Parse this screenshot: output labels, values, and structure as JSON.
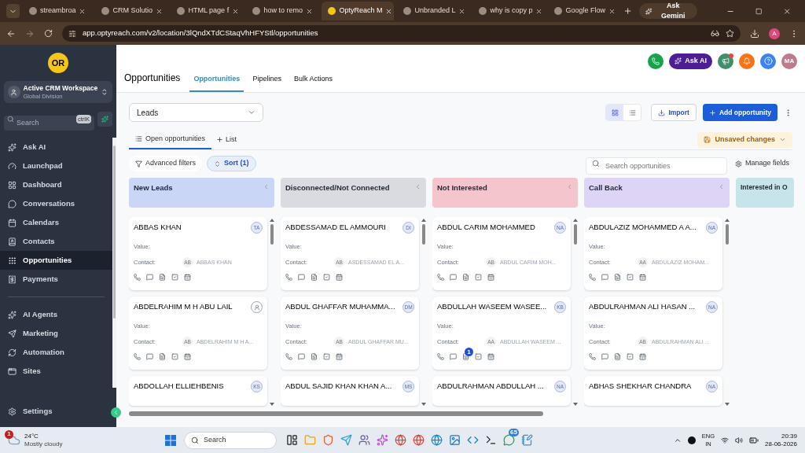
{
  "browser": {
    "tabs": [
      {
        "title": "streambroa",
        "selected": false
      },
      {
        "title": "CRM Solutio",
        "selected": false
      },
      {
        "title": "HTML page f",
        "selected": false
      },
      {
        "title": "how to remo",
        "selected": false
      },
      {
        "title": "OptyReach M",
        "selected": true
      },
      {
        "title": "Unbranded L",
        "selected": false
      },
      {
        "title": "why is copy p",
        "selected": false
      },
      {
        "title": "Google Flow",
        "selected": false
      }
    ],
    "gemini": "Ask Gemini",
    "url": "app.optyreach.com/v2/location/3lQndXTdCStaqVhHFYStl/opportunities",
    "profile": "A"
  },
  "sidebar": {
    "logo": "OR",
    "workspace": {
      "name": "Active CRM Workspace",
      "sub": "Global Division"
    },
    "search": {
      "placeholder": "Search",
      "shortcut": "ctrlK"
    },
    "groups": [
      [
        {
          "label": "Ask AI",
          "selected": false
        },
        {
          "label": "Launchpad",
          "selected": false
        },
        {
          "label": "Dashboard",
          "selected": false
        },
        {
          "label": "Conversations",
          "selected": false
        },
        {
          "label": "Calendars",
          "selected": false
        },
        {
          "label": "Contacts",
          "selected": false
        },
        {
          "label": "Opportunities",
          "selected": true
        },
        {
          "label": "Payments",
          "selected": false
        }
      ],
      [
        {
          "label": "AI Agents",
          "selected": false
        },
        {
          "label": "Marketing",
          "selected": false
        },
        {
          "label": "Automation",
          "selected": false
        },
        {
          "label": "Sites",
          "selected": false
        }
      ]
    ],
    "settings": "Settings"
  },
  "header": {
    "title": "Opportunities",
    "tabs": [
      {
        "label": "Opportunities",
        "selected": true
      },
      {
        "label": "Pipelines",
        "selected": false
      },
      {
        "label": "Bulk Actions",
        "selected": false
      }
    ],
    "ask_ai": "Ask AI",
    "announcements_unread": true,
    "avatar": "MA"
  },
  "toolbar": {
    "pipeline": "Leads",
    "view_modes": [
      {
        "kind": "board",
        "selected": true
      },
      {
        "kind": "list",
        "selected": false
      }
    ],
    "import": "Import",
    "add": "Add opportunity",
    "view_tabs": [
      {
        "label": "Open opportunities",
        "selected": true
      }
    ],
    "add_list": "List",
    "unsaved": "Unsaved changes",
    "filters": "Advanced filters",
    "sort": "Sort (1)",
    "search_placeholder": "Search opportunities",
    "manage": "Manage fields"
  },
  "columns": [
    {
      "title": "New Leads",
      "color": "#c9d6f6",
      "cards": [
        {
          "kind": "full",
          "name": "ABBAS KHAN",
          "owner": {
            "kind": "initials",
            "text": "TA"
          },
          "value_label": "Value:",
          "contact_label": "Contact:",
          "contact_initials": "AB",
          "contact_name": "ABBAS KHAN"
        },
        {
          "kind": "full",
          "name": "ABDELRAHIM M H ABU LAIL",
          "owner": {
            "kind": "icon"
          },
          "value_label": "Value:",
          "contact_label": "Contact:",
          "contact_initials": "AB",
          "contact_name": "ABDELRAHIM M H A..."
        },
        {
          "kind": "partial",
          "name": "ABDOLLAH ELLIEHBENIS",
          "owner": {
            "kind": "initials",
            "text": "KS"
          }
        }
      ]
    },
    {
      "title": "Disconnected/Not Connected",
      "color": "#d9dbe0",
      "cards": [
        {
          "kind": "full",
          "name": "ABDESSAMAD EL AMMOURI",
          "owner": {
            "kind": "initials",
            "text": "DI"
          },
          "value_label": "Value:",
          "contact_label": "Contact:",
          "contact_initials": "AB",
          "contact_name": "ASDESSAMAD EL A..."
        },
        {
          "kind": "full",
          "name": "ABDUL GHAFFAR MUHAMMA...",
          "owner": {
            "kind": "initials",
            "text": "DM"
          },
          "value_label": "Value:",
          "contact_label": "Contact:",
          "contact_initials": "AB",
          "contact_name": "ABDUL GHAFFAR MU..."
        },
        {
          "kind": "partial",
          "name": "ABDUL SAJID KHAN KHAN A...",
          "owner": {
            "kind": "initials",
            "text": "MS"
          }
        }
      ]
    },
    {
      "title": "Not Interested",
      "color": "#f5c5cd",
      "cards": [
        {
          "kind": "full",
          "name": "ABDUL CARIM MOHAMMED",
          "owner": {
            "kind": "initials",
            "text": "NA"
          },
          "value_label": "Value:",
          "contact_label": "Contact:",
          "contact_initials": "AB",
          "contact_name": "ABDUL CARIM MOH..."
        },
        {
          "kind": "full",
          "name": "ABDULLAH WASEEM WASEE...",
          "owner": {
            "kind": "initials",
            "text": "KB"
          },
          "value_label": "Value:",
          "contact_label": "Contact:",
          "contact_initials": "AA",
          "contact_name": "ABDULLAH WASEEM ...",
          "note_badge": "1"
        },
        {
          "kind": "partial",
          "name": "ABDULRAHMAN ABDULLAH ...",
          "owner": {
            "kind": "initials",
            "text": "NA"
          }
        }
      ]
    },
    {
      "title": "Call Back",
      "color": "#ddd4f6",
      "cards": [
        {
          "kind": "full",
          "name": "ABDULAZIZ MOHAMMED A A...",
          "owner": {
            "kind": "initials",
            "text": "NA"
          },
          "value_label": "Value:",
          "contact_label": "Contact:",
          "contact_initials": "AA",
          "contact_name": "ABDULAZIZ MOHAM..."
        },
        {
          "kind": "full",
          "name": "ABDULRAHMAN ALI HASAN ...",
          "owner": {
            "kind": "initials",
            "text": "NA"
          },
          "value_label": "Value:",
          "contact_label": "Contact:",
          "contact_initials": "AB",
          "contact_name": "ABDULRAHMAN ALI ..."
        },
        {
          "kind": "partial",
          "name": "ABHAS SHEKHAR CHANDRA",
          "owner": {
            "kind": "initials",
            "text": "NA"
          }
        }
      ]
    },
    {
      "title": "Interested in O",
      "color": "#c6e4ea"
    }
  ],
  "taskbar": {
    "weather": {
      "temp": "24°C",
      "text": "Mostly cloudy",
      "badge": "1"
    },
    "search": "Search",
    "chat_badge": "65",
    "lang": "ENG",
    "region": "IN",
    "time": "20:39",
    "date": "28-06-2026"
  }
}
